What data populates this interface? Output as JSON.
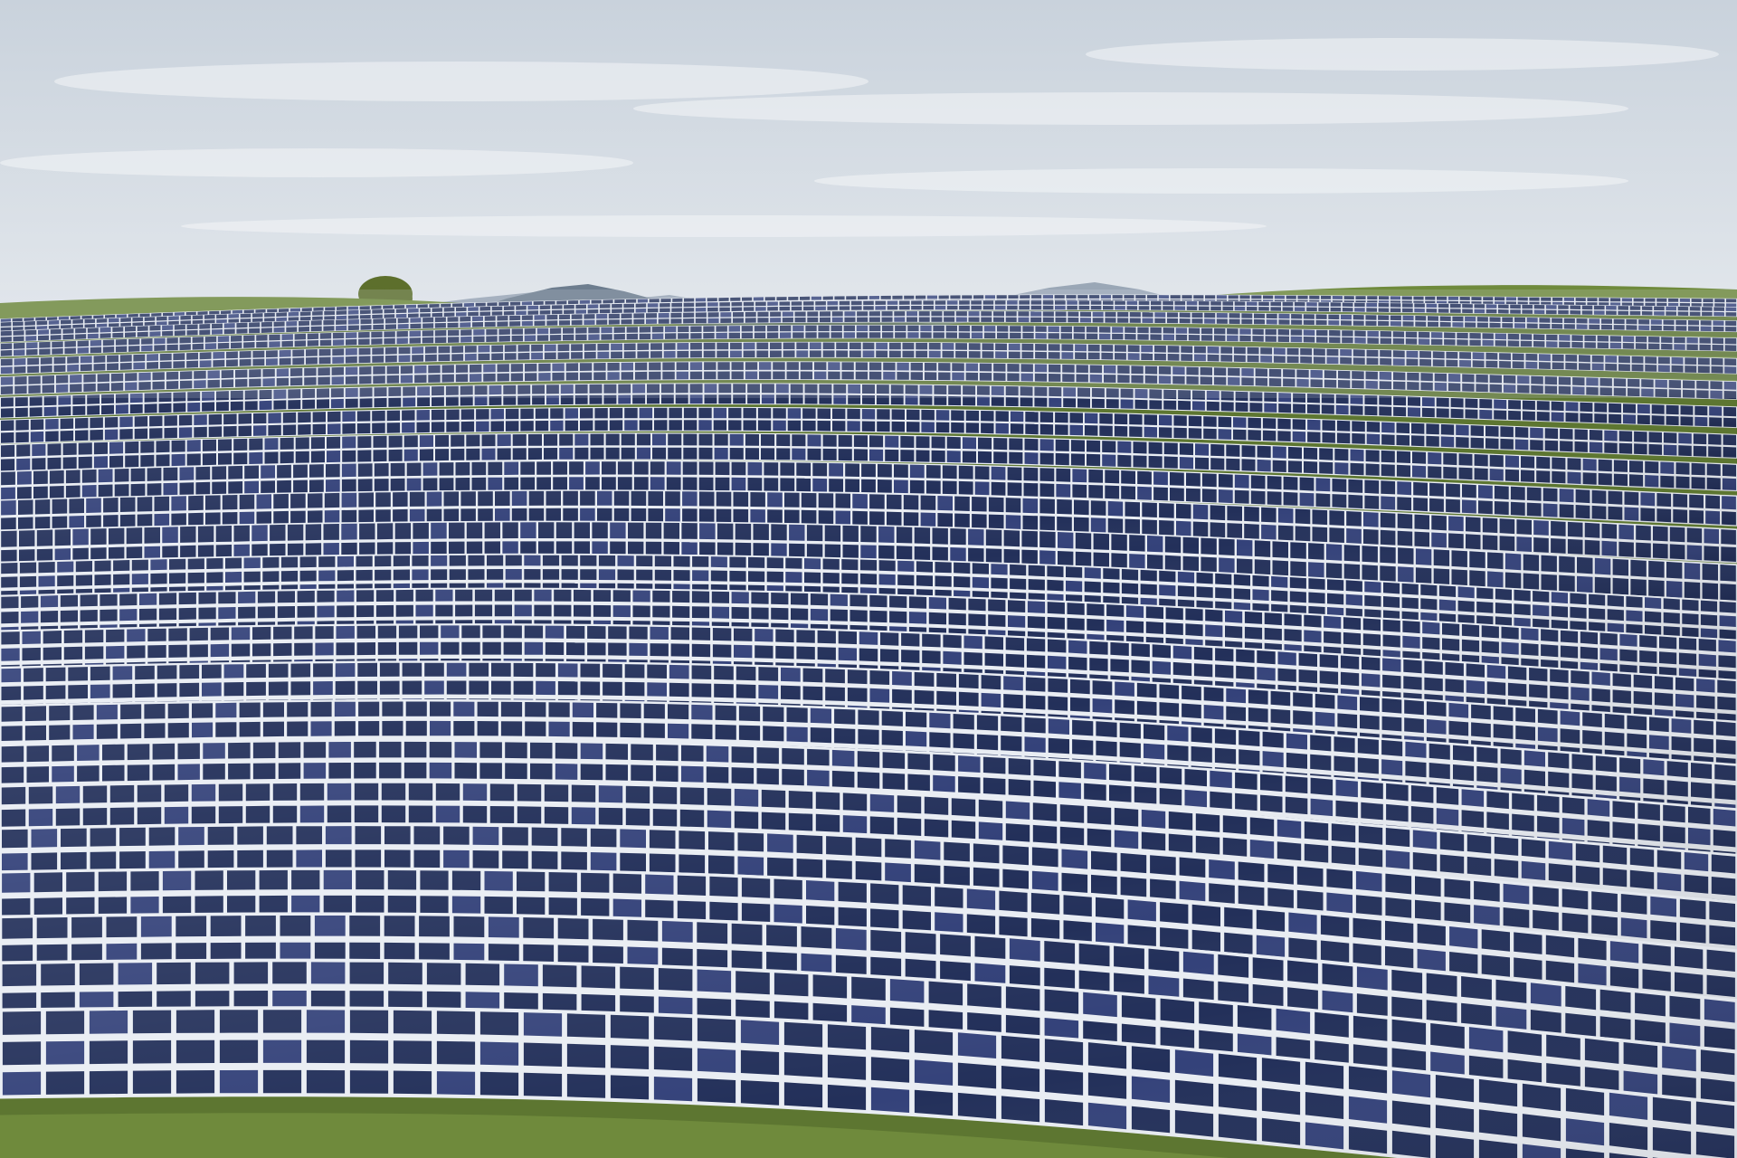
{
  "scene": {
    "subject": "solar-farm-on-rolling-hills",
    "palette": {
      "sky_top": "#c9d2dc",
      "sky_bottom": "#e7ebef",
      "cloud": "#f4f6f8",
      "mountain_far": "#9aa7b6",
      "mountain_near": "#6d7d8e",
      "grass": "#6f8a3c",
      "grass_dark": "#4e6628",
      "panel_cell": "#23305a",
      "panel_cell_light": "#34427a",
      "panel_grid": "#e9edf3",
      "panel_frame": "#c9cfd8",
      "tree": "#5d6f2c"
    }
  }
}
